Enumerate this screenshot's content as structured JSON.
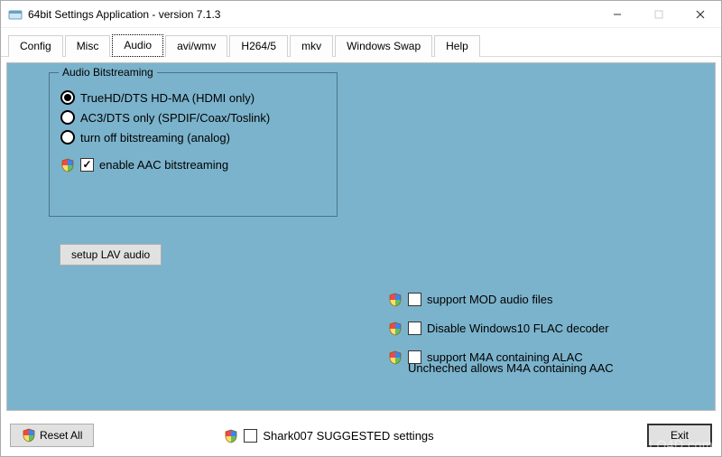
{
  "titlebar": {
    "title": "64bit Settings Application - version 7.1.3"
  },
  "tabs": [
    {
      "label": "Config"
    },
    {
      "label": "Misc"
    },
    {
      "label": "Audio"
    },
    {
      "label": "avi/wmv"
    },
    {
      "label": "H264/5"
    },
    {
      "label": "mkv"
    },
    {
      "label": "Windows Swap"
    },
    {
      "label": "Help"
    }
  ],
  "active_tab_index": 2,
  "audio": {
    "group_legend": "Audio Bitstreaming",
    "radios": [
      {
        "label": "TrueHD/DTS HD-MA (HDMI only)",
        "checked": true
      },
      {
        "label": "AC3/DTS only (SPDIF/Coax/Toslink)",
        "checked": false
      },
      {
        "label": "turn off bitstreaming (analog)",
        "checked": false
      }
    ],
    "enable_aac": {
      "label": "enable AAC bitstreaming",
      "checked": true
    },
    "setup_button": "setup LAV audio",
    "right_options": [
      {
        "label": "support MOD audio files",
        "checked": false
      },
      {
        "label": "Disable Windows10 FLAC decoder",
        "checked": false
      },
      {
        "label": "support M4A containing ALAC",
        "checked": false
      }
    ],
    "right_note": "Uncheched allows M4A containing AAC"
  },
  "bottom": {
    "reset_label": "Reset All",
    "suggested": {
      "label": "Shark007 SUGGESTED settings",
      "checked": false
    },
    "exit_label": "Exit"
  },
  "watermark": "LO4D.com"
}
